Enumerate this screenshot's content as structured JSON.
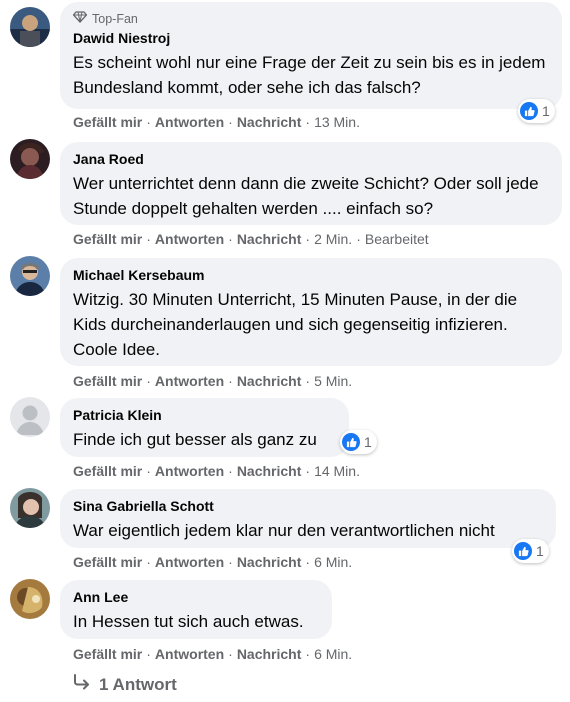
{
  "actions": {
    "like": "Gefällt mir",
    "reply": "Antworten",
    "message": "Nachricht",
    "separator": "·"
  },
  "comments": [
    {
      "badge": "Top-Fan",
      "badge_icon": "diamond-icon",
      "author": "Dawid Niestroj",
      "text": "Es scheint wohl nur eine Frage der Zeit zu sein bis es in jedem Bundesland kommt, oder sehe ich das falsch?",
      "time": "13 Min.",
      "likes": "1"
    },
    {
      "author": "Jana Roed",
      "text": "Wer unterrichtet denn dann die zweite Schicht? Oder soll jede Stunde doppelt gehalten werden .... einfach so?",
      "time": "2 Min.",
      "edited": "Bearbeitet"
    },
    {
      "author": "Michael Kersebaum",
      "text": "Witzig. 30 Minuten Unterricht, 15 Minuten Pause, in der die Kids durcheinanderlaugen und sich gegenseitig infizieren. Coole Idee.",
      "time": "5 Min."
    },
    {
      "author": "Patricia Klein",
      "text": "Finde ich gut besser als ganz zu",
      "time": "14 Min.",
      "likes": "1"
    },
    {
      "author": "Sina Gabriella Schott",
      "text": "War eigentlich jedem klar nur den verantwortlichen nicht",
      "time": "6 Min.",
      "likes": "1"
    },
    {
      "author": "Ann Lee",
      "text": "In Hessen tut sich auch etwas.",
      "time": "6 Min."
    }
  ],
  "replies_link": "1 Antwort",
  "colors": {
    "bubble": "#f0f2f5",
    "secondary_text": "#65676b",
    "like_blue": "#1877f2"
  }
}
